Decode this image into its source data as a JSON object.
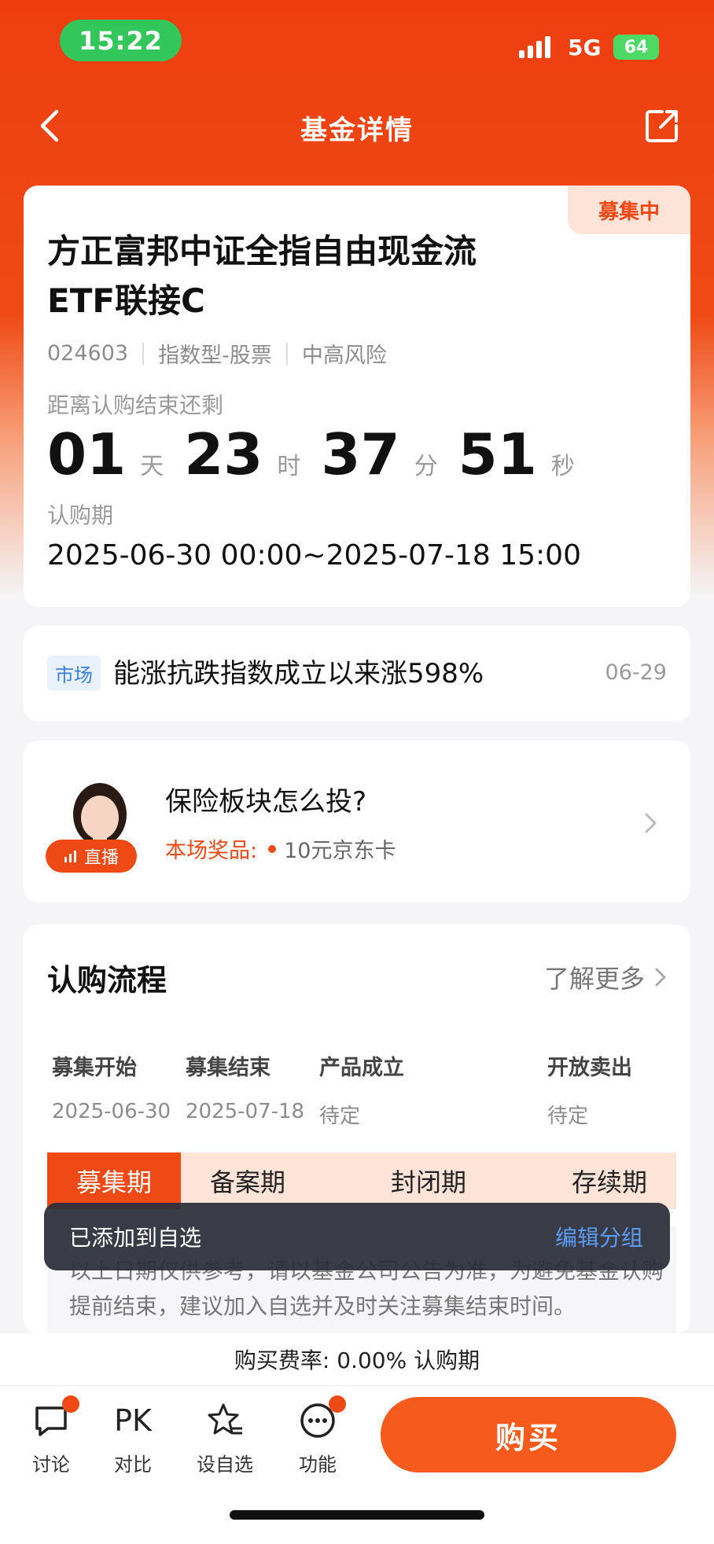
{
  "status_bar": {
    "time": "15:22",
    "network": "5G",
    "battery": "64"
  },
  "nav": {
    "title": "基金详情"
  },
  "fund": {
    "badge": "募集中",
    "name": "方正富邦中证全指自由现金流ETF联接C",
    "code": "024603",
    "type": "指数型-股票",
    "risk": "中高风险",
    "countdown_label": "距离认购结束还剩",
    "countdown": {
      "days": "01",
      "days_unit": "天",
      "hours": "23",
      "hours_unit": "时",
      "minutes": "37",
      "minutes_unit": "分",
      "seconds": "51",
      "seconds_unit": "秒"
    },
    "period_label": "认购期",
    "period": "2025-06-30 00:00~2025-07-18 15:00"
  },
  "market": {
    "tag": "市场",
    "text": "能涨抗跌指数成立以来涨598%",
    "date": "06-29"
  },
  "live": {
    "badge": "直播",
    "title": "保险板块怎么投?",
    "prize_label": "本场奖品:",
    "prize": "10元京东卡"
  },
  "process": {
    "title": "认购流程",
    "more": "了解更多",
    "steps": [
      {
        "name": "募集开始",
        "date": "2025-06-30"
      },
      {
        "name": "募集结束",
        "date": "2025-07-18"
      },
      {
        "name": "产品成立",
        "date": "待定"
      },
      {
        "name": "开放卖出",
        "date": "待定"
      }
    ],
    "phases": [
      "募集期",
      "备案期",
      "封闭期",
      "存续期"
    ],
    "note": "以上日期仅供参考，请以基金公司公告为准，为避免基金认购提前结束，建议加入自选并及时关注募集结束时间。"
  },
  "toast": {
    "text": "已添加到自选",
    "action": "编辑分组"
  },
  "fee": {
    "text": "购买费率: 0.00% 认购期"
  },
  "toolbar": {
    "discuss": "讨论",
    "compare_icon": "PK",
    "compare": "对比",
    "watchlist": "设自选",
    "more": "功能",
    "buy": "购买"
  },
  "colors": {
    "brand": "#ef4a15",
    "link": "#5b9cf5",
    "live_green": "#33c65b"
  }
}
